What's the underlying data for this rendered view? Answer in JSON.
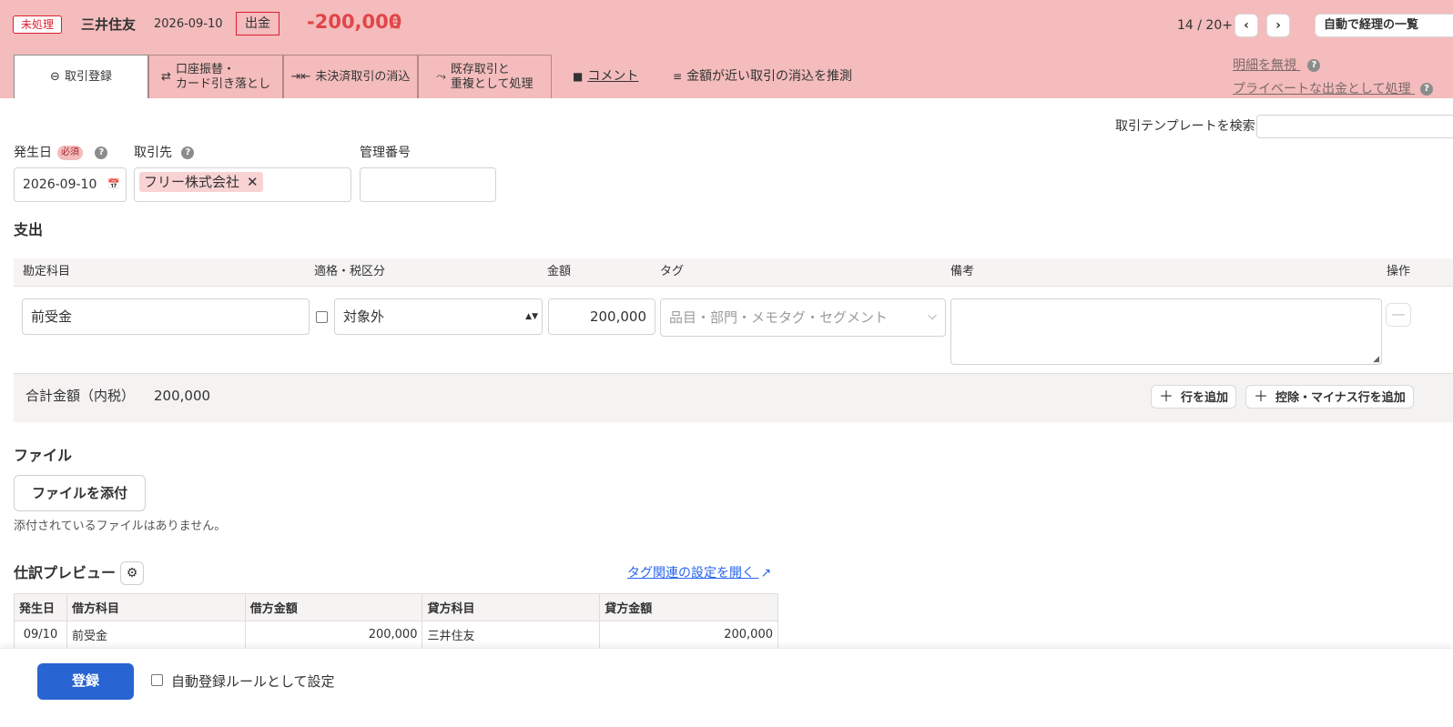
{
  "header": {
    "status": "未処理",
    "bank_name": "三井住友",
    "date": "2026-09-10",
    "type": "出金",
    "amount": "-200,000",
    "amount_unit": "円",
    "pager": "14 / 20+",
    "prev_icon": "‹",
    "next_icon": "›",
    "auto_list_label": "自動で経理の一覧"
  },
  "tabs": [
    {
      "icon": "⊖",
      "label": "取引登録"
    },
    {
      "icon": "⇄",
      "label": "口座振替・\nカード引き落とし"
    },
    {
      "icon": "⇥⇤",
      "label": "未決済取引の消込"
    },
    {
      "icon": "⤳",
      "label": "既存取引と\n重複として処理"
    }
  ],
  "links": {
    "comment": "コメント",
    "comment_icon": "■",
    "guess": "金額が近い取引の消込を推測",
    "guess_icon": "≡",
    "ignore": "明細を無視",
    "private": "プライベートな出金として処理",
    "help_icon": "?"
  },
  "form": {
    "template_search_label": "取引テンプレートを検索",
    "date_label": "発生日",
    "required_label": "必須",
    "date_value": "2026-09-10",
    "partner_label": "取引先",
    "partner_value": "フリー株式会社",
    "partner_remove": "✕",
    "mgmt_label": "管理番号",
    "calendar_icon": "📅"
  },
  "expense": {
    "title": "支出",
    "columns": {
      "account": "勘定科目",
      "tax": "適格・税区分",
      "amount": "金額",
      "tag": "タグ",
      "note": "備考",
      "ops": "操作"
    },
    "row": {
      "account": "前受金",
      "tax": "対象外",
      "amount": "200,000",
      "tag_placeholder": "品目・部門・メモタグ・セグメント"
    },
    "total_label": "合計金額（内税）",
    "total_value": "200,000",
    "add_row": "行を追加",
    "add_minus_row": "控除・マイナス行を追加"
  },
  "file": {
    "title": "ファイル",
    "attach": "ファイルを添付",
    "empty": "添付されているファイルはありません。"
  },
  "preview": {
    "title": "仕訳プレビュー",
    "tag_settings_link": "タグ関連の設定を開く",
    "columns": [
      "発生日",
      "借方科目",
      "借方金額",
      "貸方科目",
      "貸方金額"
    ],
    "rows": [
      [
        "09/10",
        "前受金",
        "200,000",
        "三井住友",
        "200,000"
      ]
    ]
  },
  "footer": {
    "submit": "登録",
    "auto_rule": "自動登録ルールとして設定"
  }
}
